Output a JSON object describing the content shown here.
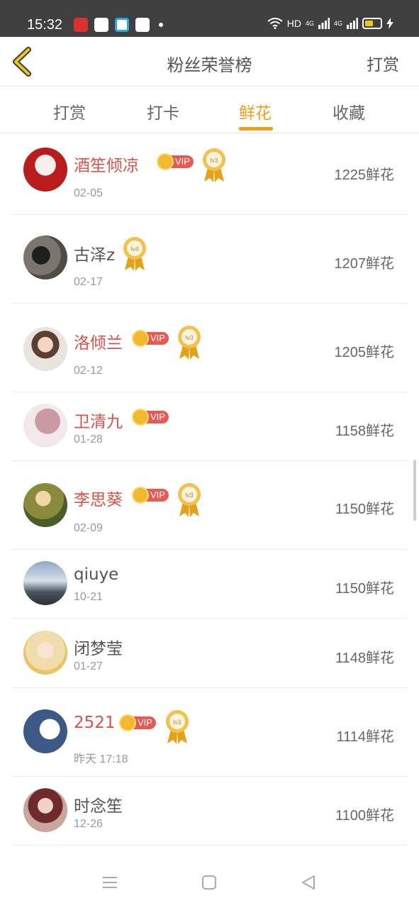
{
  "status_bar": {
    "time": "15:32",
    "network": "HD",
    "signal1": "4G",
    "signal2": "4G"
  },
  "header": {
    "title": "粉丝荣誉榜",
    "action": "打赏"
  },
  "tabs": [
    {
      "label": "打赏",
      "active": false
    },
    {
      "label": "打卡",
      "active": false
    },
    {
      "label": "鲜花",
      "active": true
    },
    {
      "label": "收藏",
      "active": false
    }
  ],
  "colors": {
    "accent": "#eba11a",
    "vip_name": "#d9534a",
    "vip_tag": "#e55b54"
  },
  "vip_label": "VIP",
  "fans": [
    {
      "name": "酒笙倾凉",
      "date": "02-05",
      "count": "1225鲜花",
      "vip": true,
      "medal": "lv3"
    },
    {
      "name": "古泽z",
      "date": "02-17",
      "count": "1207鲜花",
      "vip": false,
      "medal": "lv4"
    },
    {
      "name": "洛倾兰",
      "date": "02-12",
      "count": "1205鲜花",
      "vip": true,
      "medal": "lv3"
    },
    {
      "name": "卫清九",
      "date": "01-28",
      "count": "1158鲜花",
      "vip": true,
      "medal": ""
    },
    {
      "name": "李思葵",
      "date": "02-09",
      "count": "1150鲜花",
      "vip": true,
      "medal": "lv3"
    },
    {
      "name": "qiuye",
      "date": "10-21",
      "count": "1150鲜花",
      "vip": false,
      "medal": ""
    },
    {
      "name": "闭梦莹",
      "date": "01-27",
      "count": "1148鲜花",
      "vip": false,
      "medal": ""
    },
    {
      "name": "2521",
      "date": "昨天 17:18",
      "count": "1114鲜花",
      "vip": true,
      "medal": "lv3"
    },
    {
      "name": "时念笙",
      "date": "12-26",
      "count": "1100鲜花",
      "vip": false,
      "medal": ""
    }
  ]
}
